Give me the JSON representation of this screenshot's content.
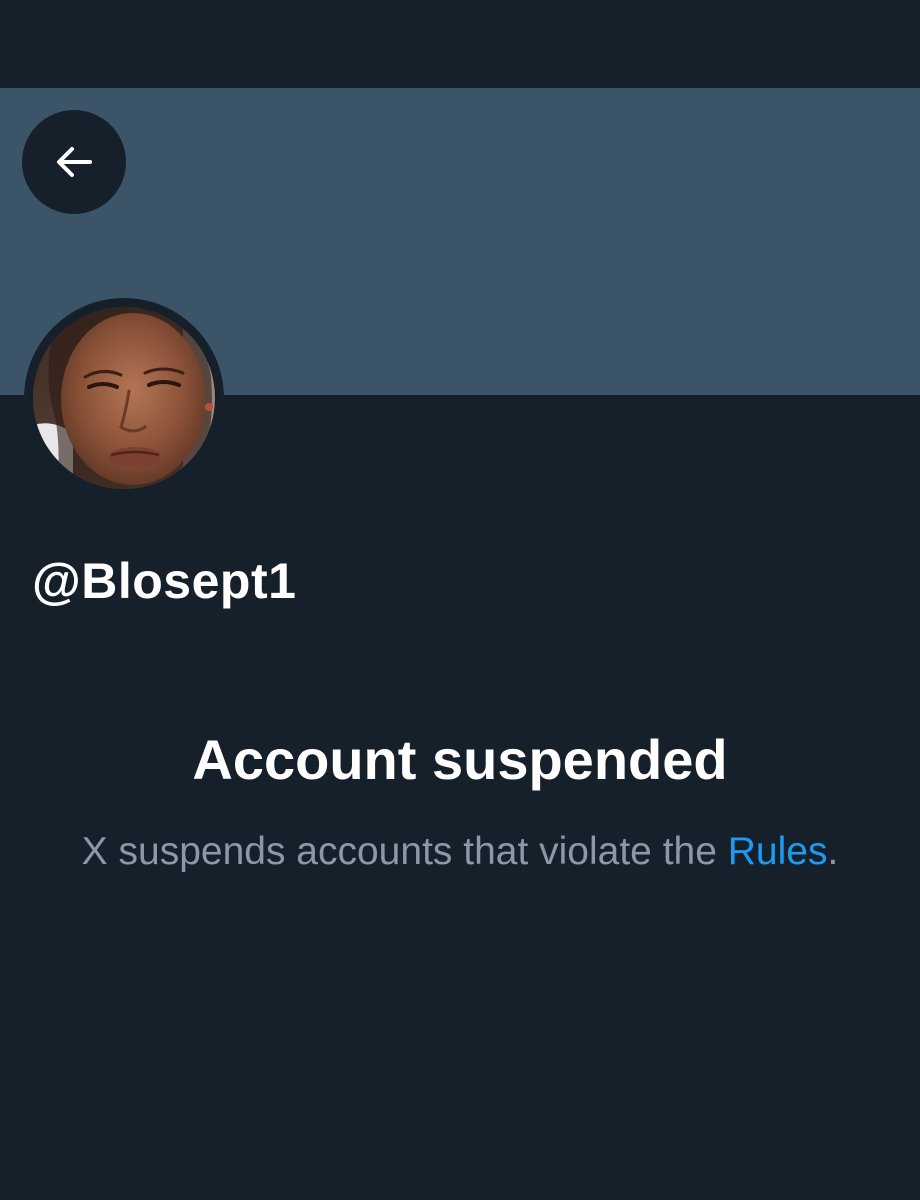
{
  "profile": {
    "handle": "@Blosept1",
    "back_icon": "arrow-left-icon",
    "avatar": "profile-photo"
  },
  "suspension": {
    "title": "Account suspended",
    "message_before": "X suspends accounts that violate the ",
    "rules_link_label": "Rules",
    "message_after": "."
  },
  "colors": {
    "background": "#16202a",
    "banner": "#3c5467",
    "link": "#1d9bf0",
    "secondary_text": "#8b98a5",
    "primary_text": "#ffffff"
  }
}
